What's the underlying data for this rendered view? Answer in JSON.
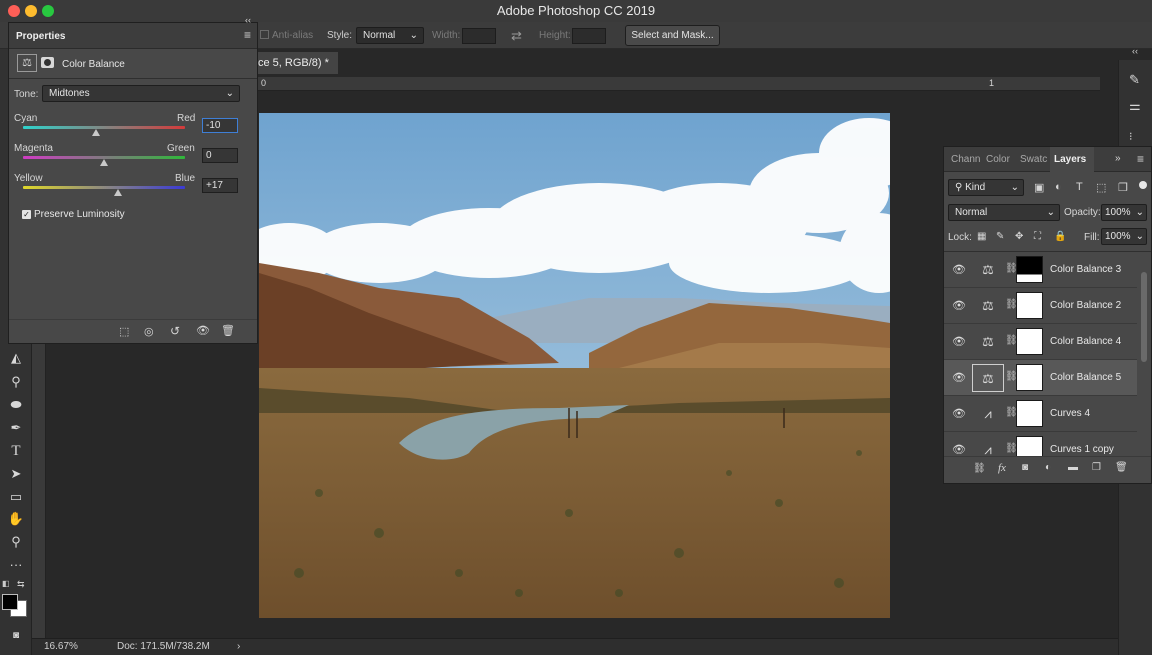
{
  "window": {
    "title": "Adobe Photoshop CC 2019"
  },
  "options_bar": {
    "anti_alias_label": "Anti-alias",
    "style_label": "Style:",
    "style_value": "Normal",
    "width_label": "Width:",
    "height_label": "Height:",
    "select_mask_label": "Select and Mask..."
  },
  "document": {
    "tab_title": "ce 5, RGB/8) *",
    "ruler_ticks": [
      "0",
      "1"
    ],
    "zoom": "16.67%",
    "doc_size": "Doc: 171.5M/738.2M"
  },
  "properties": {
    "panel_title": "Properties",
    "adjustment_name": "Color Balance",
    "tone_label": "Tone:",
    "tone_value": "Midtones",
    "sliders": [
      {
        "left_label": "Cyan",
        "right_label": "Red",
        "value": "-10",
        "level": -10
      },
      {
        "left_label": "Magenta",
        "right_label": "Green",
        "value": "0",
        "level": 0
      },
      {
        "left_label": "Yellow",
        "right_label": "Blue",
        "value": "+17",
        "level": 17
      }
    ],
    "preserve_luminosity_label": "Preserve Luminosity",
    "preserve_luminosity_checked": true
  },
  "layers_panel": {
    "tabs": [
      "Chann",
      "Color",
      "Swatc",
      "Layers"
    ],
    "active_tab": "Layers",
    "filter_kind": "Kind",
    "blend_mode": "Normal",
    "opacity_label": "Opacity:",
    "opacity_value": "100%",
    "lock_label": "Lock:",
    "fill_label": "Fill:",
    "fill_value": "100%",
    "layers": [
      {
        "name": "Color Balance 3",
        "kind": "color-balance",
        "mask": "mostly-black"
      },
      {
        "name": "Color Balance 2",
        "kind": "color-balance",
        "mask": "white"
      },
      {
        "name": "Color Balance 4",
        "kind": "color-balance",
        "mask": "white"
      },
      {
        "name": "Color Balance 5",
        "kind": "color-balance",
        "mask": "white",
        "selected": true
      },
      {
        "name": "Curves 4",
        "kind": "curves",
        "mask": "white"
      },
      {
        "name": "Curves 1 copy",
        "kind": "curves",
        "mask": "white"
      }
    ]
  },
  "colors": {
    "accent_selected": "#585858",
    "panel_bg": "#484848"
  }
}
